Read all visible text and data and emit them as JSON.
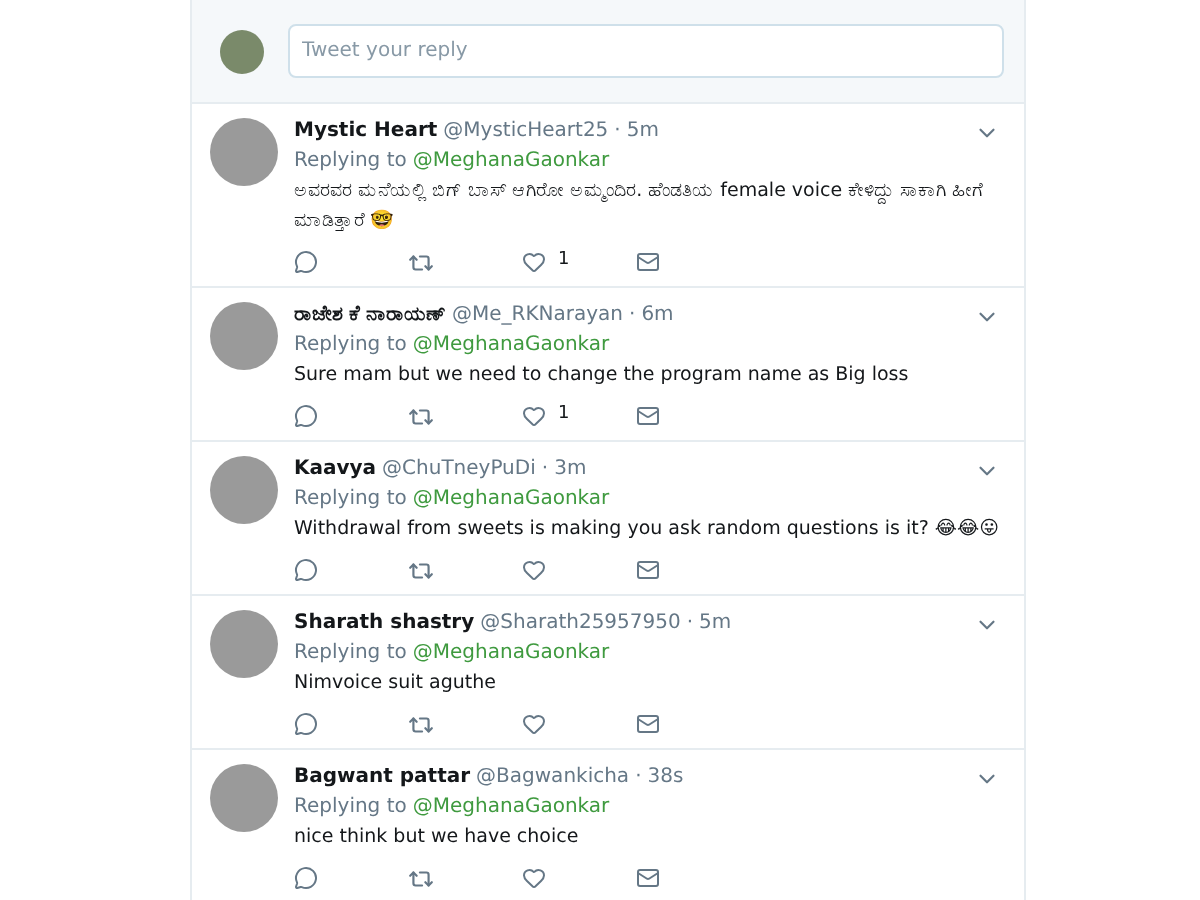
{
  "reply_bar": {
    "placeholder": "Tweet your reply"
  },
  "tweets": [
    {
      "name": "Mystic Heart",
      "handle": "@MysticHeart25",
      "time": "5m",
      "replying_label": "Replying to",
      "replying_to": "@MeghanaGaonkar",
      "text": "ಅವರವರ ಮನೆಯಲ್ಲಿ ಬಿಗ್ ಬಾಸ್ ಆಗಿರೋ ಅಮ್ಮಂದಿರ.  ಹೆಂಡತಿಯ female voice ಕೇಳಿದ್ದು ಸಾಕಾಗಿ ಹೀಗೆ ಮಾಡಿತ್ತಾರೆ 🤓",
      "likes": "1",
      "separator": "·"
    },
    {
      "name": "ರಾಜೇಶ ಕೆ ನಾರಾಯಣ್",
      "handle": "@Me_RKNarayan",
      "time": "6m",
      "replying_label": "Replying to",
      "replying_to": "@MeghanaGaonkar",
      "text": "Sure mam but we need to change the program name as Big loss",
      "likes": "1",
      "separator": "·"
    },
    {
      "name": "Kaavya",
      "handle": "@ChuTneyPuDi",
      "time": "3m",
      "replying_label": "Replying to",
      "replying_to": "@MeghanaGaonkar",
      "text": "Withdrawal from sweets is making you ask random questions is it? 😂😂😛",
      "separator": "·"
    },
    {
      "name": "Sharath shastry",
      "handle": "@Sharath25957950",
      "time": "5m",
      "replying_label": "Replying to",
      "replying_to": "@MeghanaGaonkar",
      "text": "Nimvoice suit aguthe",
      "separator": "·"
    },
    {
      "name": "Bagwant pattar",
      "handle": "@Bagwankicha",
      "time": "38s",
      "replying_label": "Replying to",
      "replying_to": "@MeghanaGaonkar",
      "text": "nice think but we have choice",
      "separator": "·"
    }
  ]
}
